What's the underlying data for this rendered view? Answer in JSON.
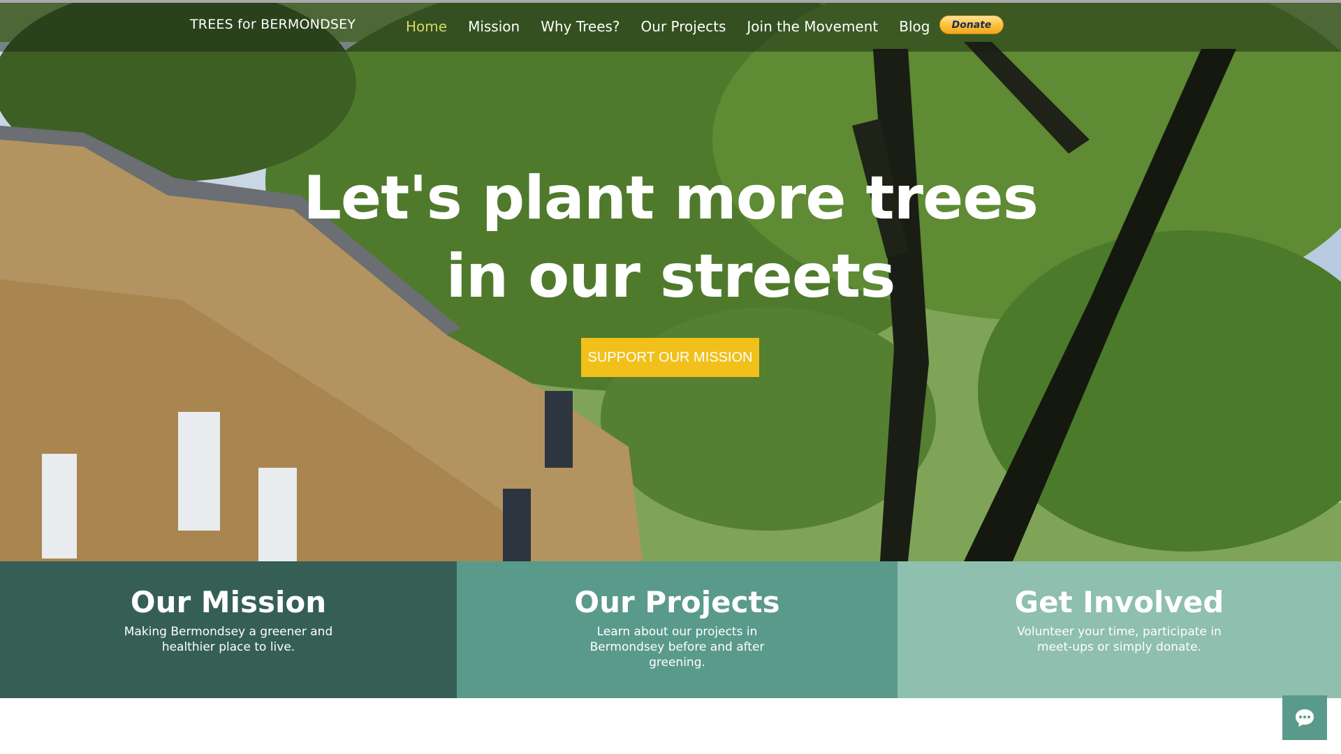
{
  "brand": "TREES for BERMONDSEY",
  "nav": {
    "items": [
      {
        "label": "Home",
        "active": true
      },
      {
        "label": "Mission",
        "active": false
      },
      {
        "label": "Why Trees?",
        "active": false
      },
      {
        "label": "Our Projects",
        "active": false
      },
      {
        "label": "Join the Movement",
        "active": false
      },
      {
        "label": "Blog",
        "active": false
      }
    ],
    "donate_label": "Donate"
  },
  "hero": {
    "headline_line1": "Let's plant more trees",
    "headline_line2": "in our streets",
    "cta_label": "SUPPORT OUR MISSION"
  },
  "cards": [
    {
      "title": "Our Mission",
      "text": "Making Bermondsey a greener and healthier place to live."
    },
    {
      "title": "Our Projects",
      "text": "Learn about our projects in Bermondsey before and after greening."
    },
    {
      "title": "Get Involved",
      "text": "Volunteer your time, participate in meet-ups or simply donate."
    }
  ],
  "chat": {
    "icon": "chat-bubble-icon"
  },
  "colors": {
    "active_nav": "#d9d66a",
    "cta": "#f2c01a",
    "card_mission": "#355f55",
    "card_projects": "#5a9a8a",
    "card_involved": "#8fbfae"
  }
}
